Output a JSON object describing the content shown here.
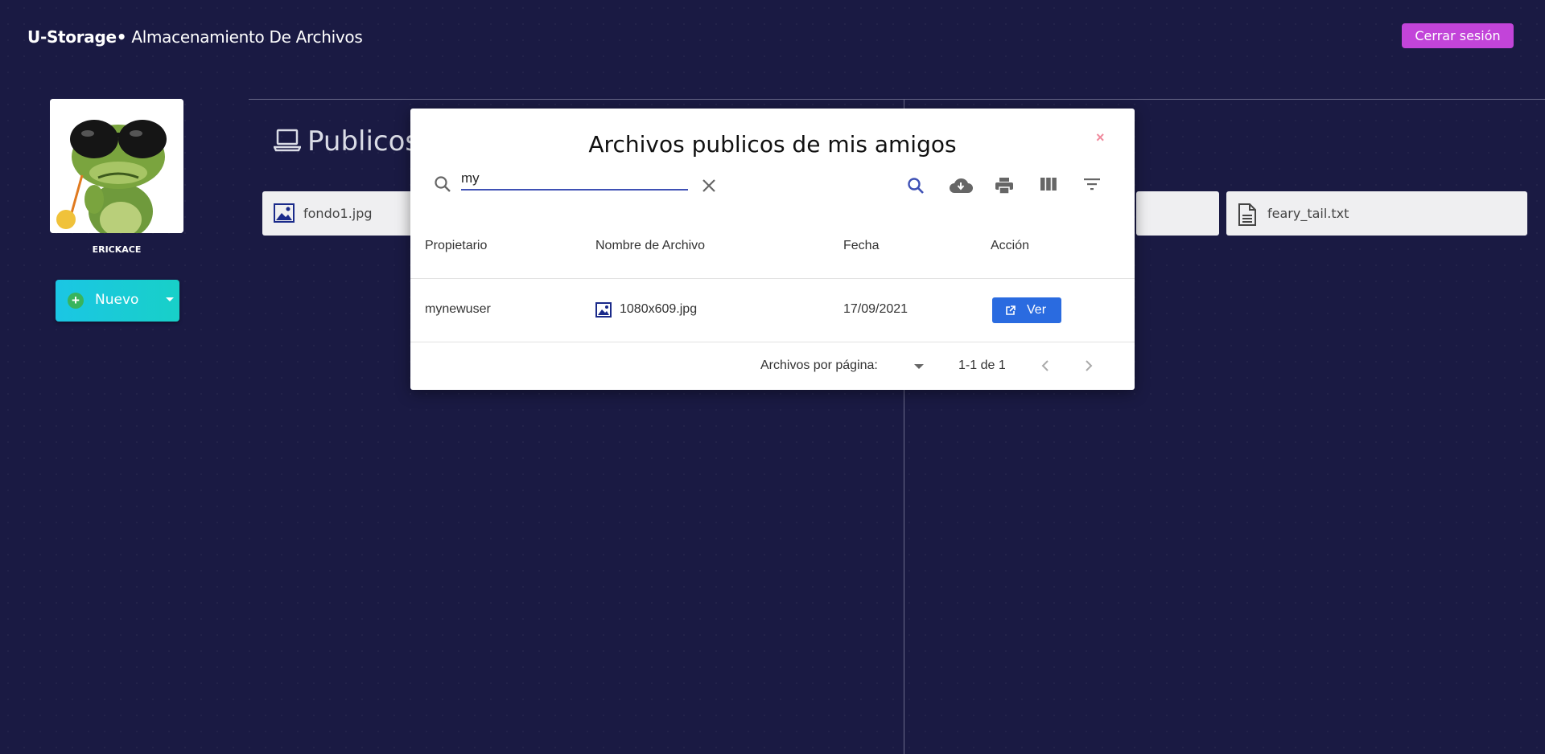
{
  "header": {
    "brand_bold": "U-Storage",
    "brand_bullet": "•",
    "brand_subtitle": "Almacenamiento De Archivos",
    "logout_label": "Cerrar sesión"
  },
  "profile": {
    "username": "ERICKACE",
    "new_button_label": "Nuevo"
  },
  "section": {
    "title": "Publicos",
    "files": [
      {
        "name": "fondo1.jpg",
        "icon": "image-file-icon"
      },
      {
        "name": "feary_tail.txt",
        "icon": "text-file-icon"
      }
    ]
  },
  "modal": {
    "title": "Archivos publicos de mis amigos",
    "close_label": "×",
    "search_value": "my",
    "toolbar_icons": [
      "search-icon",
      "cloud-download-icon",
      "print-icon",
      "view-column-icon",
      "filter-icon"
    ],
    "columns": [
      "Propietario",
      "Nombre de Archivo",
      "Fecha",
      "Acción"
    ],
    "rows": [
      {
        "owner": "mynewuser",
        "filename": "1080x609.jpg",
        "date": "17/09/2021",
        "action": "Ver"
      }
    ],
    "pagination": {
      "per_page_label": "Archivos por página:",
      "range": "1-1 de 1"
    }
  },
  "colors": {
    "background": "#1a1a43",
    "logout": "#c244d9",
    "new_button": "#1bc6e4",
    "ver_button": "#2a6be0",
    "search_underline": "#3f51b5"
  }
}
